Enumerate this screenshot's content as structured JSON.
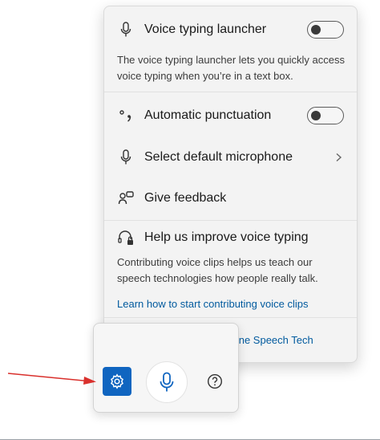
{
  "menu": {
    "voice_launcher": {
      "label": "Voice typing launcher",
      "toggle_state": "off",
      "description": "The voice typing launcher lets you quickly access voice typing when you’re in a text box."
    },
    "auto_punctuation": {
      "label": "Automatic punctuation",
      "toggle_state": "off"
    },
    "microphone": {
      "label": "Select default microphone"
    },
    "feedback": {
      "label": "Give feedback"
    },
    "improve": {
      "label": "Help us improve voice typing",
      "description": "Contributing voice clips helps us teach our speech technologies how people really talk.",
      "link": "Learn how to start contributing voice clips"
    },
    "powered_by": "Powered by Microsoft Online Speech Tech"
  },
  "dock": {
    "settings_icon": "gear-icon",
    "mic_icon": "microphone-icon",
    "help_icon": "question-circle-icon"
  },
  "colors": {
    "accent": "#1065c0",
    "link": "#005a9e",
    "annotation_arrow": "#d9302c"
  }
}
